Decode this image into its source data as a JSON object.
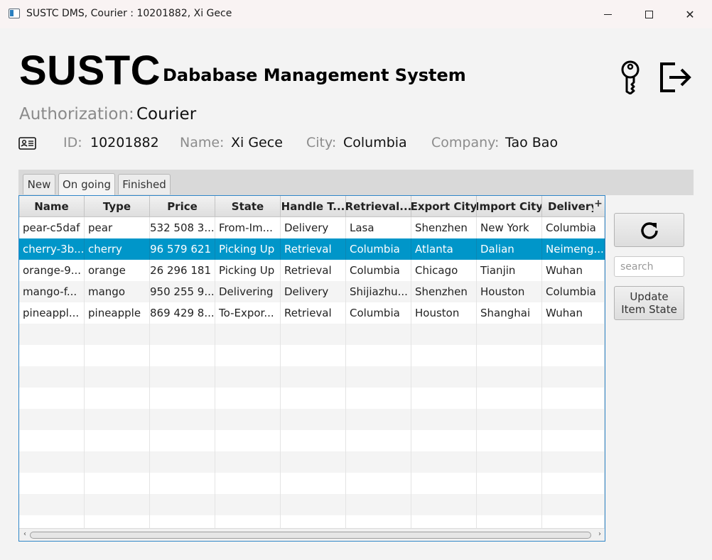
{
  "window": {
    "title": "SUSTC DMS, Courier : 10201882, Xi Gece",
    "minimize": "",
    "maximize": "",
    "close": "✕"
  },
  "header": {
    "brand": "SUSTC",
    "subtitle": "Dababase Management System"
  },
  "authorization": {
    "label": "Authorization:",
    "value": "Courier"
  },
  "user_info": {
    "id_label": "ID:",
    "id_value": "10201882",
    "name_label": "Name:",
    "name_value": "Xi Gece",
    "city_label": "City:",
    "city_value": "Columbia",
    "company_label": "Company:",
    "company_value": "Tao Bao"
  },
  "tabs": [
    {
      "label": "New"
    },
    {
      "label": "On going"
    },
    {
      "label": "Finished"
    }
  ],
  "table": {
    "columns": [
      "Name",
      "Type",
      "Price",
      "State",
      "Handle T...",
      "Retrieval...",
      "Export City",
      "Import City",
      "Delivery"
    ],
    "column_menu": "+",
    "rows": [
      [
        "pear-c5daf",
        "pear",
        "532 508 3...",
        "From-Im...",
        "Delivery",
        "Lasa",
        "Shenzhen",
        "New York",
        "Columbia"
      ],
      [
        "cherry-3b...",
        "cherry",
        "96 579 621",
        "Picking Up",
        "Retrieval",
        "Columbia",
        "Atlanta",
        "Dalian",
        "Neimeng..."
      ],
      [
        "orange-9...",
        "orange",
        "26 296 181",
        "Picking Up",
        "Retrieval",
        "Columbia",
        "Chicago",
        "Tianjin",
        "Wuhan"
      ],
      [
        "mango-f...",
        "mango",
        "950 255 9...",
        "Delivering",
        "Delivery",
        "Shijiazhu...",
        "Shenzhen",
        "Houston",
        "Columbia"
      ],
      [
        "pineappl...",
        "pineapple",
        "869 429 8...",
        "To-Expor...",
        "Retrieval",
        "Columbia",
        "Houston",
        "Shanghai",
        "Wuhan"
      ]
    ],
    "selected_row": 1,
    "scroll_left": "‹",
    "scroll_right": "›"
  },
  "controls": {
    "search_placeholder": "search",
    "update_label_line1": "Update",
    "update_label_line2": "Item State"
  },
  "colors": {
    "selection": "#0096c9",
    "table_border": "#2f86c8"
  }
}
